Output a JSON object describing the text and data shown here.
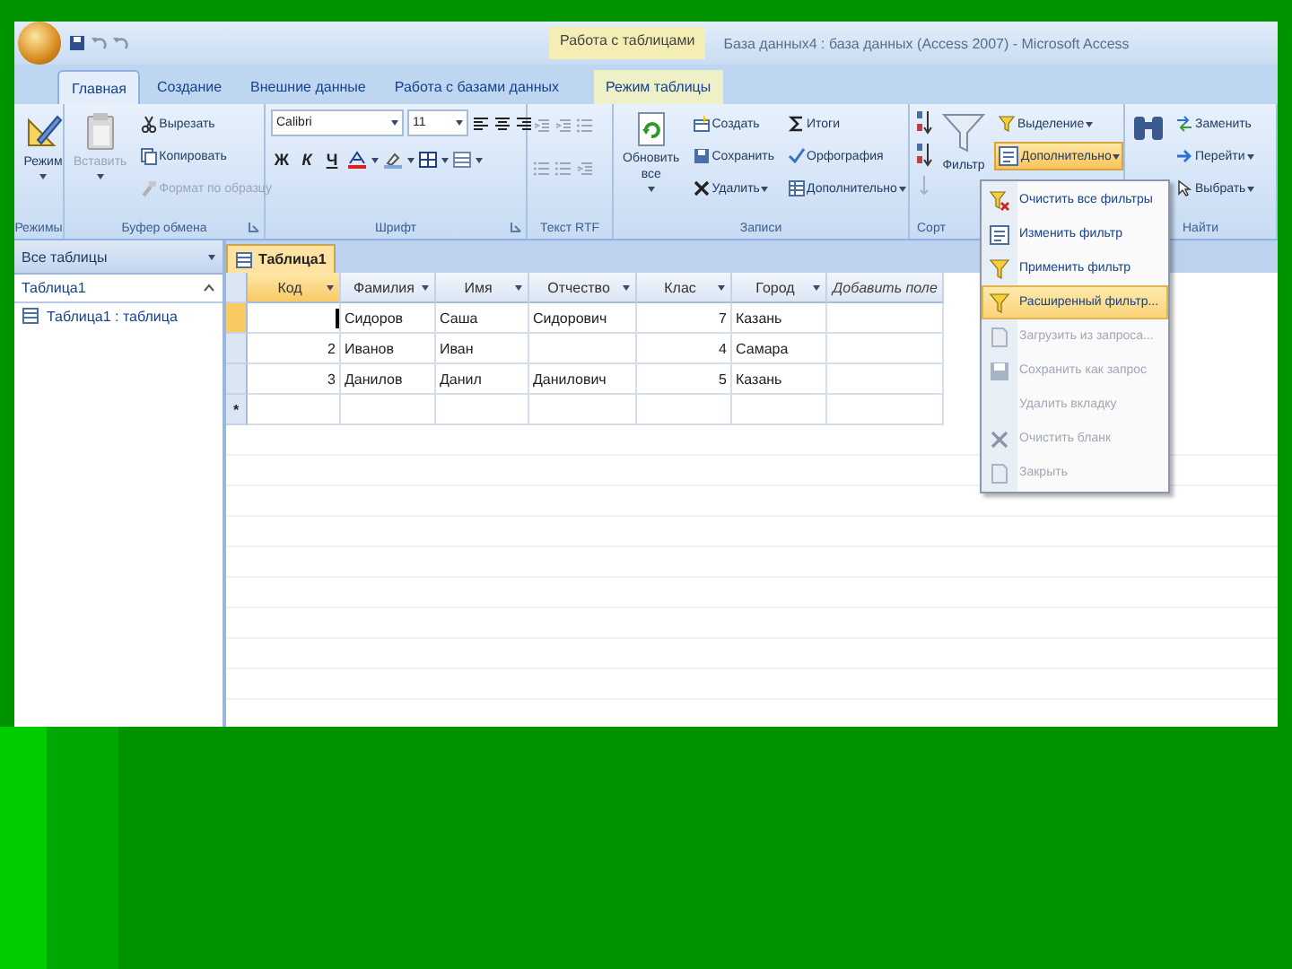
{
  "title_bar": {
    "context_label": "Работа с таблицами",
    "title": "База данных4 : база данных (Access 2007) - Microsoft Access"
  },
  "tabs": [
    {
      "label": "Главная",
      "selected": true,
      "kind": "normal"
    },
    {
      "label": "Создание",
      "selected": false,
      "kind": "normal"
    },
    {
      "label": "Внешние данные",
      "selected": false,
      "kind": "normal"
    },
    {
      "label": "Работа с базами данных",
      "selected": false,
      "kind": "normal"
    },
    {
      "label": "Режим таблицы",
      "selected": false,
      "kind": "contextual"
    }
  ],
  "ribbon": {
    "groups": [
      {
        "label": "Режимы",
        "launcher": false,
        "buttons": [
          {
            "kind": "large",
            "label": "Режим",
            "dropdown": true,
            "disabled": false
          }
        ]
      },
      {
        "label": "Буфер обмена",
        "launcher": true,
        "buttons": [
          {
            "kind": "large",
            "label": "Вставить",
            "dropdown": true,
            "disabled": true
          },
          {
            "kind": "small",
            "label": "Вырезать",
            "dropdown": false,
            "disabled": false
          },
          {
            "kind": "small",
            "label": "Копировать",
            "dropdown": false,
            "disabled": false
          },
          {
            "kind": "small",
            "label": "Формат по образцу",
            "dropdown": false,
            "disabled": true
          }
        ]
      },
      {
        "label": "Шрифт",
        "launcher": true,
        "buttons": [
          {
            "kind": "combo",
            "label": "Calibri"
          },
          {
            "kind": "combo",
            "label": "11"
          },
          {
            "kind": "format",
            "label": "Ж"
          },
          {
            "kind": "format",
            "label": "К"
          },
          {
            "kind": "format",
            "label": "Ч"
          }
        ]
      },
      {
        "label": "Текст RTF",
        "launcher": false
      },
      {
        "label": "Записи",
        "launcher": false,
        "buttons": [
          {
            "kind": "large",
            "label": "Обновить все",
            "dropdown": true,
            "disabled": false
          },
          {
            "kind": "small",
            "label": "Создать",
            "dropdown": false,
            "disabled": false
          },
          {
            "kind": "small",
            "label": "Сохранить",
            "dropdown": false,
            "disabled": false
          },
          {
            "kind": "small",
            "label": "Удалить",
            "dropdown": true,
            "disabled": false
          },
          {
            "kind": "small",
            "label": "Итоги",
            "dropdown": false,
            "disabled": false
          },
          {
            "kind": "small",
            "label": "Орфография",
            "dropdown": false,
            "disabled": false
          },
          {
            "kind": "small",
            "label": "Дополнительно",
            "dropdown": true,
            "disabled": false
          }
        ]
      },
      {
        "label": "Сорт",
        "launcher": false,
        "buttons": [
          {
            "kind": "large",
            "label": "Фильтр",
            "dropdown": false,
            "disabled": false
          },
          {
            "kind": "small",
            "label": "Выделение",
            "dropdown": true,
            "disabled": false,
            "expanded": false
          },
          {
            "kind": "small",
            "label": "Дополнительно",
            "dropdown": true,
            "disabled": false,
            "expanded": true
          }
        ]
      },
      {
        "label": "Найти",
        "launcher": false,
        "buttons": [
          {
            "kind": "small",
            "label": "Заменить",
            "dropdown": false,
            "disabled": false
          },
          {
            "kind": "small",
            "label": "Перейти",
            "dropdown": true,
            "disabled": false
          },
          {
            "kind": "small",
            "label": "Выбрать",
            "dropdown": true,
            "disabled": false
          }
        ]
      }
    ]
  },
  "menu": {
    "items": [
      {
        "label": "Очистить все фильтры",
        "disabled": false,
        "selected": false
      },
      {
        "label": "Изменить фильтр",
        "disabled": false,
        "selected": false
      },
      {
        "label": "Применить фильтр",
        "disabled": false,
        "selected": false
      },
      {
        "label": "Расширенный фильтр...",
        "disabled": false,
        "selected": true
      },
      {
        "label": "Загрузить из запроса...",
        "disabled": true,
        "selected": false
      },
      {
        "label": "Сохранить как запрос",
        "disabled": true,
        "selected": false
      },
      {
        "label": "Удалить вкладку",
        "disabled": true,
        "selected": false
      },
      {
        "label": "Очистить бланк",
        "disabled": true,
        "selected": false
      },
      {
        "label": "Закрыть",
        "disabled": true,
        "selected": false
      }
    ]
  },
  "navigation_pane": {
    "header": "Все таблицы",
    "groups": [
      {
        "label": "Таблица1",
        "expanded": true,
        "children": [
          {
            "label": "Таблица1 : таблица",
            "selected": false
          }
        ]
      }
    ]
  },
  "datasheet": {
    "tab": "Таблица1",
    "columns": [
      {
        "label": "Код",
        "selected": true,
        "dropdown": true
      },
      {
        "label": "Фамилия",
        "selected": false,
        "dropdown": true
      },
      {
        "label": "Имя",
        "selected": false,
        "dropdown": true
      },
      {
        "label": "Отчество",
        "selected": false,
        "dropdown": true
      },
      {
        "label": "Клас",
        "selected": false,
        "dropdown": true
      },
      {
        "label": "Город",
        "selected": false,
        "dropdown": true
      },
      {
        "label": "Добавить поле",
        "selected": false,
        "dropdown": false
      }
    ],
    "rows": [
      {
        "selected": true,
        "editing": true,
        "cells": [
          null,
          "Сидоров",
          "Саша",
          "Сидорович",
          "7",
          "Казань",
          null
        ]
      },
      {
        "selected": false,
        "editing": false,
        "cells": [
          "2",
          "Иванов",
          "Иван",
          null,
          "4",
          "Самара",
          null
        ]
      },
      {
        "selected": false,
        "editing": false,
        "cells": [
          "3",
          "Данилов",
          "Данил",
          "Данилович",
          "5",
          "Казань",
          null
        ]
      }
    ],
    "new_row_marker": "*"
  }
}
